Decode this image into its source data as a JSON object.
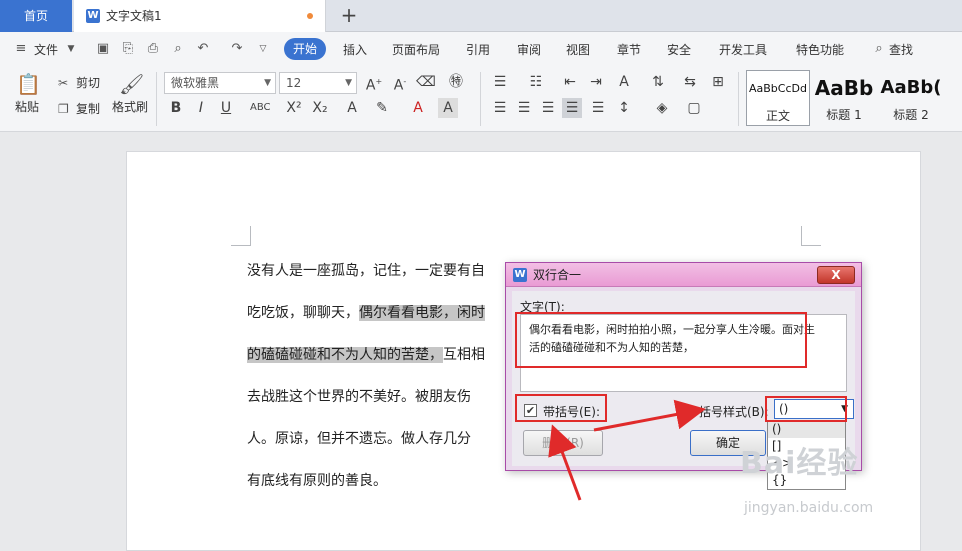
{
  "tabs": {
    "home": "首页",
    "document": "文字文稿1",
    "new_tab": "+"
  },
  "menu": {
    "file": "文件",
    "active": "开始",
    "items": [
      "插入",
      "页面布局",
      "引用",
      "审阅",
      "视图",
      "章节",
      "安全",
      "开发工具",
      "特色功能"
    ],
    "search": "查找"
  },
  "toolbar": {
    "paste": "粘贴",
    "cut": "剪切",
    "copy": "复制",
    "format_painter": "格式刷",
    "font_name": "微软雅黑",
    "font_size": "12",
    "styles": [
      {
        "sample": "AaBbCcDd",
        "name": "正文"
      },
      {
        "sample": "AaBb",
        "name": "标题 1"
      },
      {
        "sample": "AaBb(",
        "name": "标题 2"
      }
    ]
  },
  "document": {
    "lines": [
      {
        "before": "没有人是一座孤岛，记住，一定要有自",
        "hl": "",
        "after": ""
      },
      {
        "before": "吃吃饭，聊聊天，",
        "hl": "偶尔看看电影，闲时",
        "after": ""
      },
      {
        "before": "",
        "hl": "的磕磕碰碰和不为人知的苦楚，",
        "after": "互相相"
      },
      {
        "before": "去战胜这个世界的不美好。被朋友伤",
        "hl": "",
        "after": ""
      },
      {
        "before": "人。原谅，但并不遗忘。做人存几分",
        "hl": "",
        "after": ""
      },
      {
        "before": "有底线有原则的善良。",
        "hl": "",
        "after": ""
      }
    ]
  },
  "dialog": {
    "title": "双行合一",
    "close": "X",
    "text_label": "文字(T):",
    "text_line1": "偶尔看看电影，闲时拍拍小照，一起分享人生冷暖。面对生",
    "text_line2": "活的磕磕碰碰和不为人知的苦楚，",
    "bracket_checkbox": "带括号(E):",
    "bracket_style_label": "括号样式(B):",
    "bracket_style_value": "()",
    "delete_button": "删除(R)",
    "ok_button": "确定",
    "dropdown_options": [
      "()",
      "[]",
      "<>",
      "{}"
    ]
  },
  "watermark": {
    "brand": "Bai经验",
    "url": "jingyan.baidu.com"
  }
}
